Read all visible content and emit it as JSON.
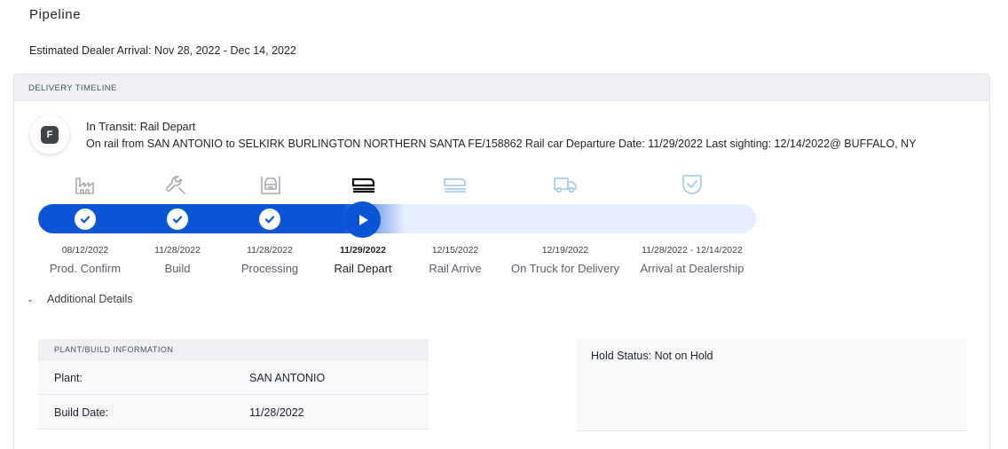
{
  "page": {
    "title": "Pipeline",
    "eta_label": "Estimated Dealer Arrival:",
    "eta_range": "Nov 28, 2022 - Dec 14, 2022"
  },
  "timeline": {
    "header": "DELIVERY TIMELINE",
    "avatar_letter": "F",
    "status_label": "In Transit:",
    "status_value": "Rail Depart",
    "route_text": "On rail from SAN ANTONIO to SELKIRK BURLINGTON NORTHERN SANTA FE/158862 Rail car Departure Date: 11/29/2022 Last sighting: 12/14/2022@ BUFFALO, NY",
    "progress_fraction": 0.51,
    "stages": [
      {
        "name": "Prod. Confirm",
        "date": "08/12/2022",
        "icon": "factory-icon",
        "state": "complete"
      },
      {
        "name": "Build",
        "date": "11/28/2022",
        "icon": "wrench-icon",
        "state": "complete"
      },
      {
        "name": "Processing",
        "date": "11/28/2022",
        "icon": "car-lift-icon",
        "state": "complete"
      },
      {
        "name": "Rail Depart",
        "date": "11/29/2022",
        "icon": "rail-car-icon",
        "state": "current"
      },
      {
        "name": "Rail Arrive",
        "date": "12/15/2022",
        "icon": "rail-car-icon",
        "state": "pending"
      },
      {
        "name": "On Truck for Delivery",
        "date": "12/19/2022",
        "icon": "truck-icon",
        "state": "pending"
      },
      {
        "name": "Arrival at Dealership",
        "date": "11/28/2022 - 12/14/2022",
        "icon": "shield-check-icon",
        "state": "pending"
      }
    ]
  },
  "details": {
    "toggle_label": "Additional Details",
    "plant_header": "PLANT/BUILD INFORMATION",
    "rows": [
      {
        "key": "Plant:",
        "value": "SAN ANTONIO"
      },
      {
        "key": "Build Date:",
        "value": "11/28/2022"
      }
    ],
    "hold_status": "Hold Status: Not on Hold"
  },
  "colors": {
    "accent_blue": "#0a55d6",
    "track_light": "#e6efff",
    "icon_done": "#a7abb1",
    "icon_current": "#111111",
    "icon_pending": "#a9cdee"
  }
}
